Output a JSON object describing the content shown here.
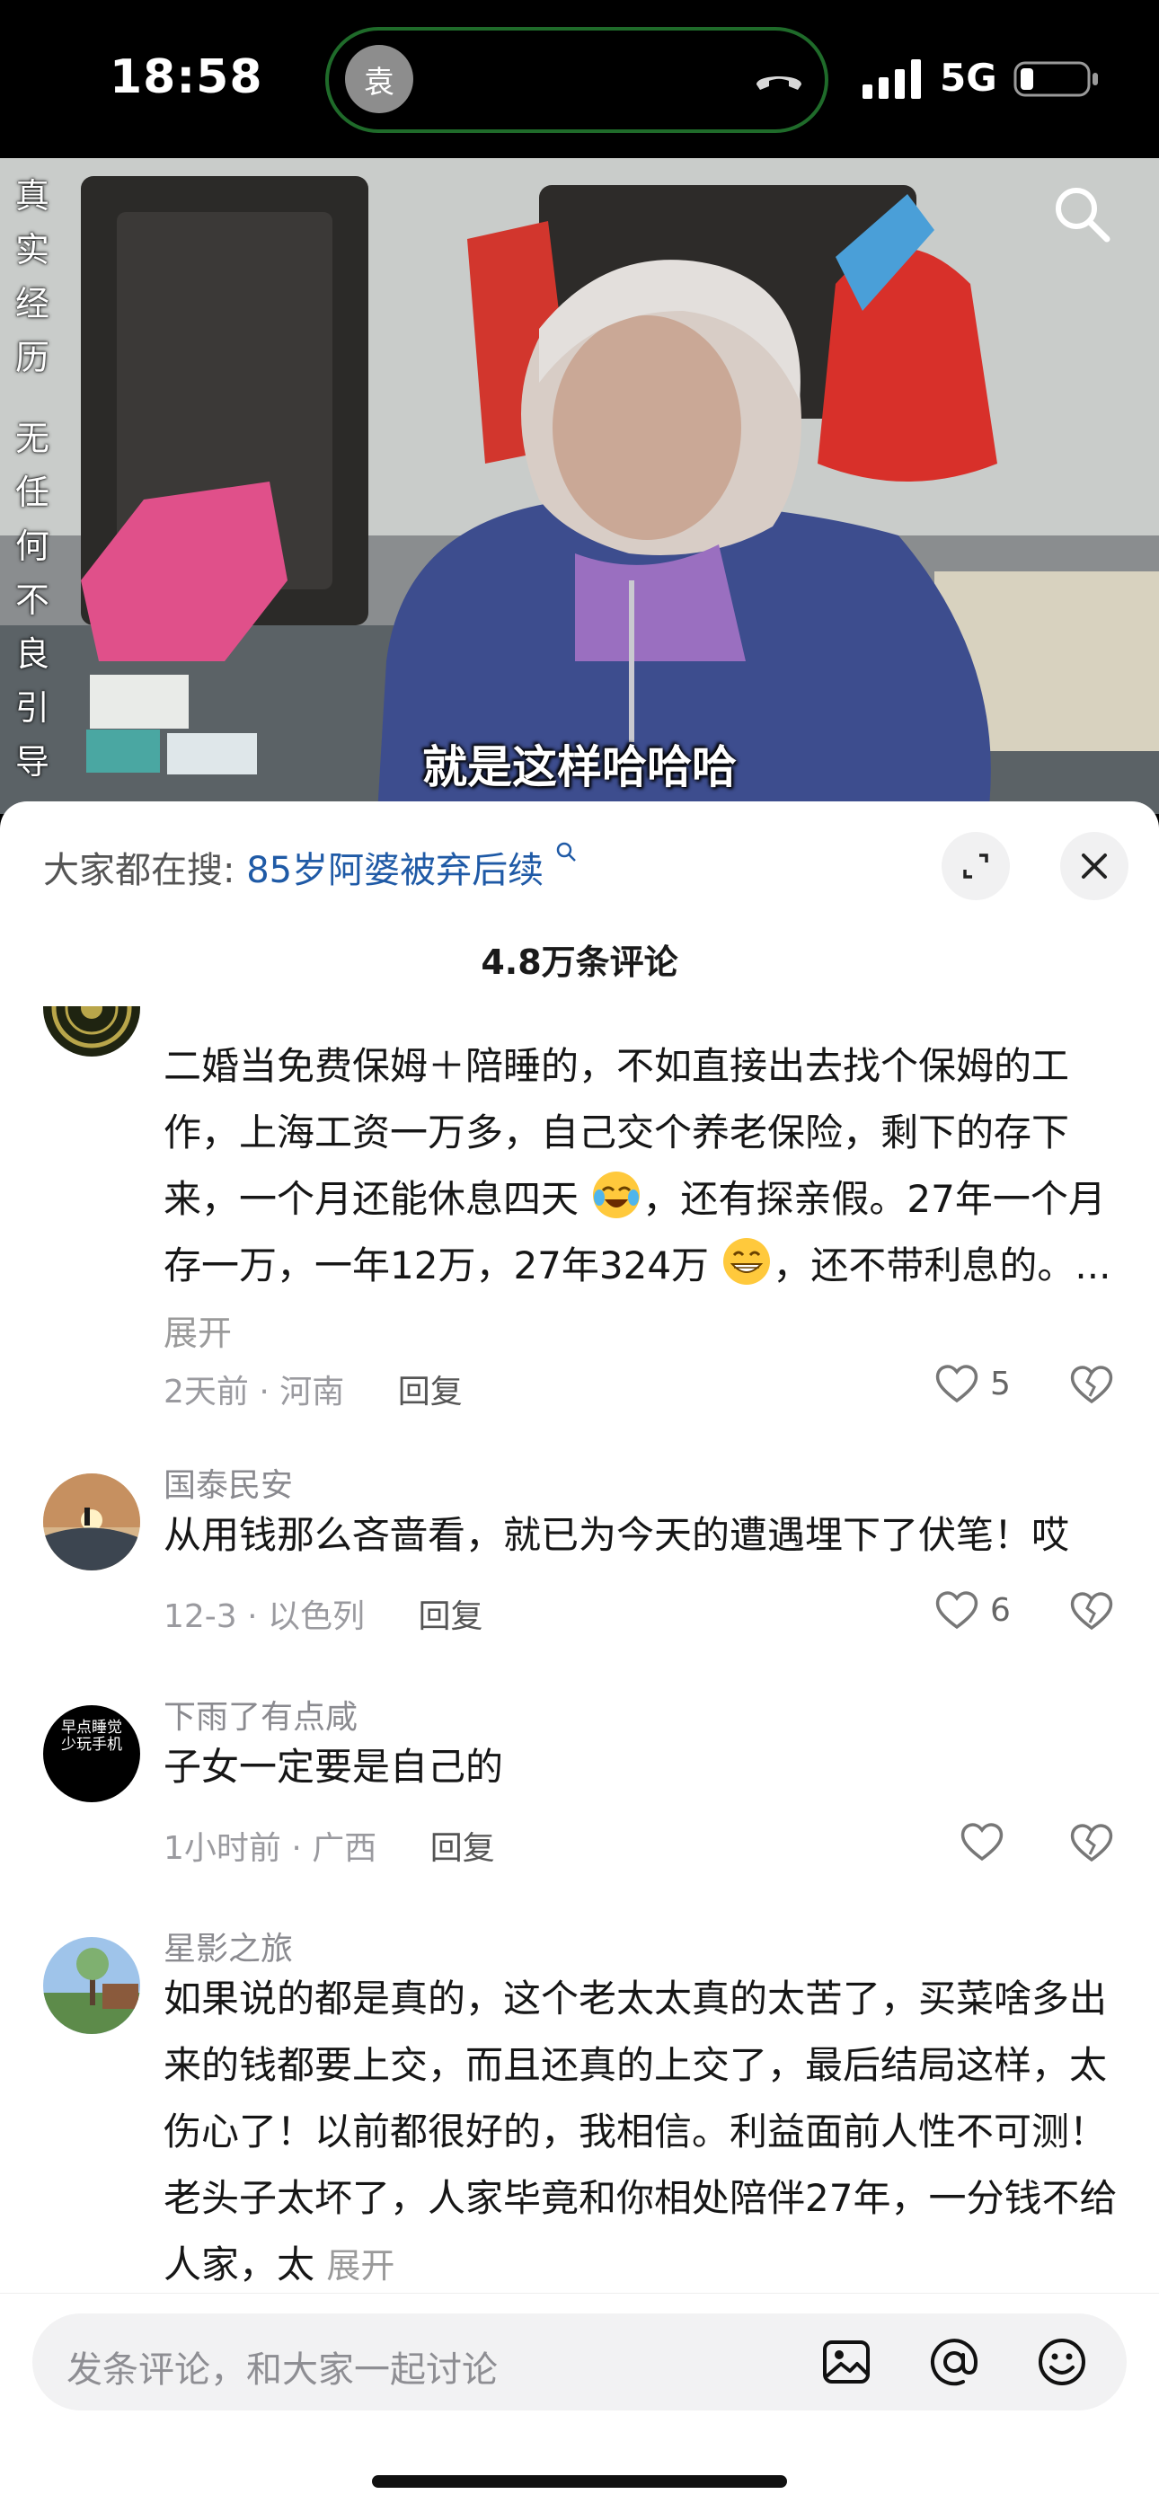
{
  "status_bar": {
    "time": "18:58",
    "island_avatar_char": "袁",
    "network": "5G"
  },
  "video": {
    "side_text_1": "真实经历",
    "side_text_2": "无任何不良引导",
    "caption": "就是这样哈哈哈"
  },
  "search_hint": {
    "label": "大家都在搜:",
    "query": "85岁阿婆被弃后续"
  },
  "comment_count": "4.8万条评论",
  "comments": [
    {
      "username": "",
      "text_parts": [
        "二婚当免费保姆＋陪睡的，不如直接出去找个保姆的工作，上海工资一万多，自己交个养老保险，剩下的存下来，一个月还能休息四天",
        "，还有探亲假。27年一个月存一万，一年12万，27年324万",
        "，还不带利息的。... "
      ],
      "expand": "展开",
      "time_location": "2天前 · 河南",
      "reply": "回复",
      "likes": "5"
    },
    {
      "username": "国泰民安",
      "text": "从用钱那么吝啬看，就已为今天的遭遇埋下了伏笔！哎",
      "time_location": "12-3 · 以色列",
      "reply": "回复",
      "likes": "6"
    },
    {
      "username": "下雨了有点咸",
      "avatar_text": "早点睡觉少玩手机",
      "text": "子女一定要是自己的",
      "time_location": "1小时前 · 广西",
      "reply": "回复",
      "likes": ""
    },
    {
      "username": "星影之旅",
      "text": "如果说的都是真的，这个老太太真的太苦了，买菜啥多出来的钱都要上交，而且还真的上交了，最后结局这样，太伤心了！以前都很好的，我相信。利益面前人性不可测！老头子太坏了，人家毕竟和你相处陪伴27年，一分钱不给人家，太 ",
      "expand": "展开"
    }
  ],
  "input": {
    "placeholder": "发条评论，和大家一起讨论"
  },
  "icons": {
    "image": "image-icon",
    "mention": "at-icon",
    "emoji": "emoji-icon"
  }
}
